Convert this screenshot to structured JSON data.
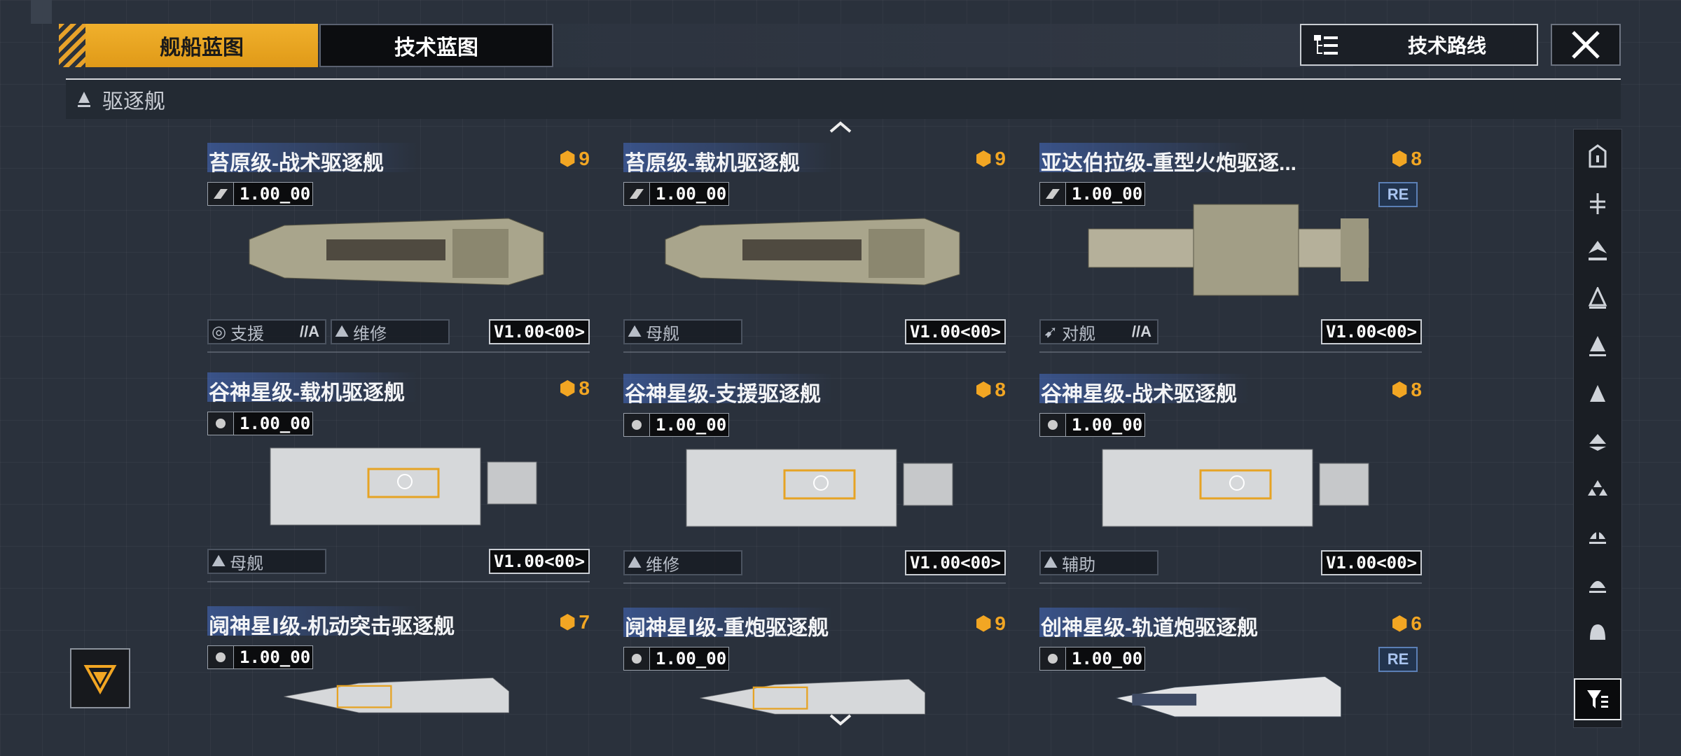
{
  "tabs": {
    "ship_blueprint": "舰船蓝图",
    "tech_blueprint": "技术蓝图"
  },
  "tech_route_label": "技术路线",
  "category": {
    "label": "驱逐舰"
  },
  "ships": [
    {
      "name": "苔原级-战术驱逐舰",
      "tier": "9",
      "version_small": "1.00_00",
      "roles": [
        {
          "label": "支援",
          "rank": "//A"
        },
        {
          "label": "维修",
          "rank": ""
        }
      ],
      "version": "V1.00<00>",
      "re": ""
    },
    {
      "name": "苔原级-载机驱逐舰",
      "tier": "9",
      "version_small": "1.00_00",
      "roles": [
        {
          "label": "母舰",
          "rank": ""
        }
      ],
      "version": "V1.00<00>",
      "re": ""
    },
    {
      "name": "亚达伯拉级-重型火炮驱逐...",
      "tier": "8",
      "version_small": "1.00_00",
      "roles": [
        {
          "label": "对舰",
          "rank": "//A"
        }
      ],
      "version": "V1.00<00>",
      "re": "RE"
    },
    {
      "name": "谷神星级-载机驱逐舰",
      "tier": "8",
      "version_small": "1.00_00",
      "roles": [
        {
          "label": "母舰",
          "rank": ""
        }
      ],
      "version": "V1.00<00>",
      "re": ""
    },
    {
      "name": "谷神星级-支援驱逐舰",
      "tier": "8",
      "version_small": "1.00_00",
      "roles": [
        {
          "label": "维修",
          "rank": ""
        }
      ],
      "version": "V1.00<00>",
      "re": ""
    },
    {
      "name": "谷神星级-战术驱逐舰",
      "tier": "8",
      "version_small": "1.00_00",
      "roles": [
        {
          "label": "辅助",
          "rank": ""
        }
      ],
      "version": "V1.00<00>",
      "re": ""
    },
    {
      "name": "阋神星Ⅰ级-机动突击驱逐舰",
      "tier": "7",
      "version_small": "1.00_00",
      "roles": [],
      "version": "",
      "re": ""
    },
    {
      "name": "阋神星Ⅰ级-重炮驱逐舰",
      "tier": "9",
      "version_small": "1.00_00",
      "roles": [],
      "version": "",
      "re": ""
    },
    {
      "name": "创神星级-轨道炮驱逐舰",
      "tier": "6",
      "version_small": "1.00_00",
      "roles": [],
      "version": "",
      "re": "RE"
    }
  ],
  "colors": {
    "accent": "#f0b02c",
    "tier": "#f2a623",
    "title_highlight": "#466ec8"
  },
  "filter_icons": [
    "carrier-icon",
    "frigate-icon",
    "destroyer-icon",
    "cruiser-icon",
    "battlecruiser-icon",
    "capital-icon",
    "support-icon",
    "fleet-icon",
    "station-icon",
    "dome-icon",
    "bell-icon",
    "filter-icon"
  ]
}
